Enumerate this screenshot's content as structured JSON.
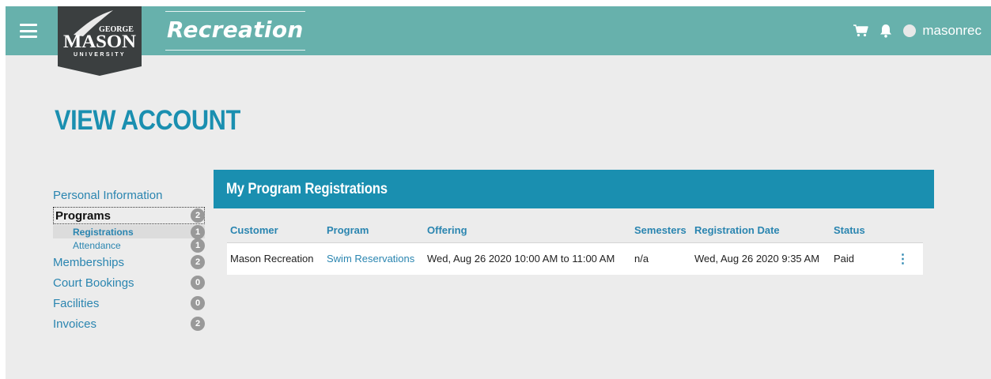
{
  "header": {
    "brand_title": "Recreation",
    "logo": {
      "top": "GEORGE",
      "main": "MASON",
      "bottom": "UNIVERSITY"
    },
    "username": "masonrec",
    "icons": [
      "menu-icon",
      "cart-icon",
      "bell-icon",
      "avatar-icon"
    ]
  },
  "page": {
    "title": "VIEW ACCOUNT"
  },
  "sidebar": {
    "personal": {
      "label": "Personal Information"
    },
    "programs": {
      "label": "Programs",
      "count": "2"
    },
    "registrations": {
      "label": "Registrations",
      "count": "1"
    },
    "attendance": {
      "label": "Attendance",
      "count": "1"
    },
    "memberships": {
      "label": "Memberships",
      "count": "2"
    },
    "court_bookings": {
      "label": "Court Bookings",
      "count": "0"
    },
    "facilities": {
      "label": "Facilities",
      "count": "0"
    },
    "invoices": {
      "label": "Invoices",
      "count": "2"
    }
  },
  "panel": {
    "title": "My Program Registrations",
    "columns": [
      "Customer",
      "Program",
      "Offering",
      "Semesters",
      "Registration Date",
      "Status"
    ],
    "rows": [
      {
        "customer": "Mason Recreation",
        "program": "Swim Reservations",
        "offering": "Wed, Aug 26 2020 10:00 AM to 11:00 AM",
        "semesters": "n/a",
        "registration_date": "Wed, Aug 26 2020 9:35 AM",
        "status": "Paid"
      }
    ]
  },
  "colors": {
    "topbar": "#67b1ac",
    "accent": "#1a8fb0",
    "link": "#2a85b0",
    "background": "#ececec",
    "badge": "#999999"
  }
}
